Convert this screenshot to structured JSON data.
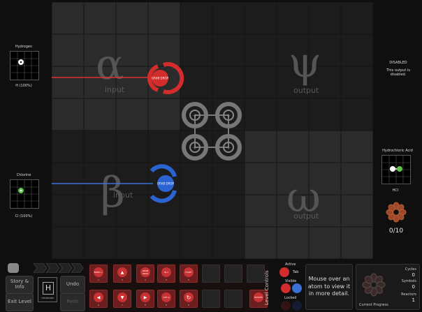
{
  "inputs": [
    {
      "region_label": "Hydrogen",
      "atom": "H",
      "formula": "H (100%)",
      "greek": "α",
      "word": "input"
    },
    {
      "region_label": "Chlorine",
      "atom": "Cl",
      "formula": "Cl (100%)",
      "greek": "β",
      "word": "input"
    }
  ],
  "outputs": [
    {
      "greek": "ψ",
      "word": "output",
      "status_title": "DISABLED",
      "status_text": "This output is disabled."
    },
    {
      "greek": "ω",
      "word": "output",
      "product_label": "Hydrochloric Acid",
      "formula": "HCl",
      "atoms": [
        "H",
        "Cl"
      ],
      "progress": "0/10"
    }
  ],
  "waldos": [
    {
      "color": "#d22c2c",
      "label": "GRAB DROP"
    },
    {
      "color": "#2c63d2",
      "label": "GRAB DROP"
    }
  ],
  "bonders": [
    "+",
    "+",
    "+",
    "+"
  ],
  "bottom_left": {
    "story_info": "Story & Info",
    "undo": "Undo",
    "exit_level": "Exit Level",
    "redo": "Redo",
    "element_symbol": "H",
    "element_name": "HYDROGEN"
  },
  "tools": [
    {
      "label": "BOND +",
      "num": "1"
    },
    {
      "label": "▲",
      "num": "2"
    },
    {
      "label": "GRAB DROP",
      "num": "3"
    },
    {
      "label": "IN α",
      "num": "4"
    },
    {
      "label": "START",
      "num": "5"
    },
    {
      "label": "◀",
      "num": "6"
    },
    {
      "label": "▼",
      "num": "7"
    },
    {
      "label": "▶",
      "num": "8"
    },
    {
      "label": "OUT ψ",
      "num": "9"
    },
    {
      "label": "↻",
      "num": "0"
    },
    {
      "label": "ROTATE",
      "num": "-"
    }
  ],
  "level_controls": {
    "title": "Level Controls",
    "active": "Active",
    "tab": "Tab",
    "visible": "Visible",
    "locked": "Locked"
  },
  "hint": "Mouse over an atom to view it in more detail.",
  "stats": {
    "cycles_label": "Cycles",
    "cycles": "0",
    "symbols_label": "Symbols",
    "symbols": "0",
    "reactors_label": "Reactors",
    "reactors": "1",
    "progress_label": "Current Progress"
  },
  "colors": {
    "red": "#c83232",
    "blue": "#3b6fd6",
    "grid_dark": "#1c1c1c",
    "grid_light": "#2b2b2b"
  }
}
